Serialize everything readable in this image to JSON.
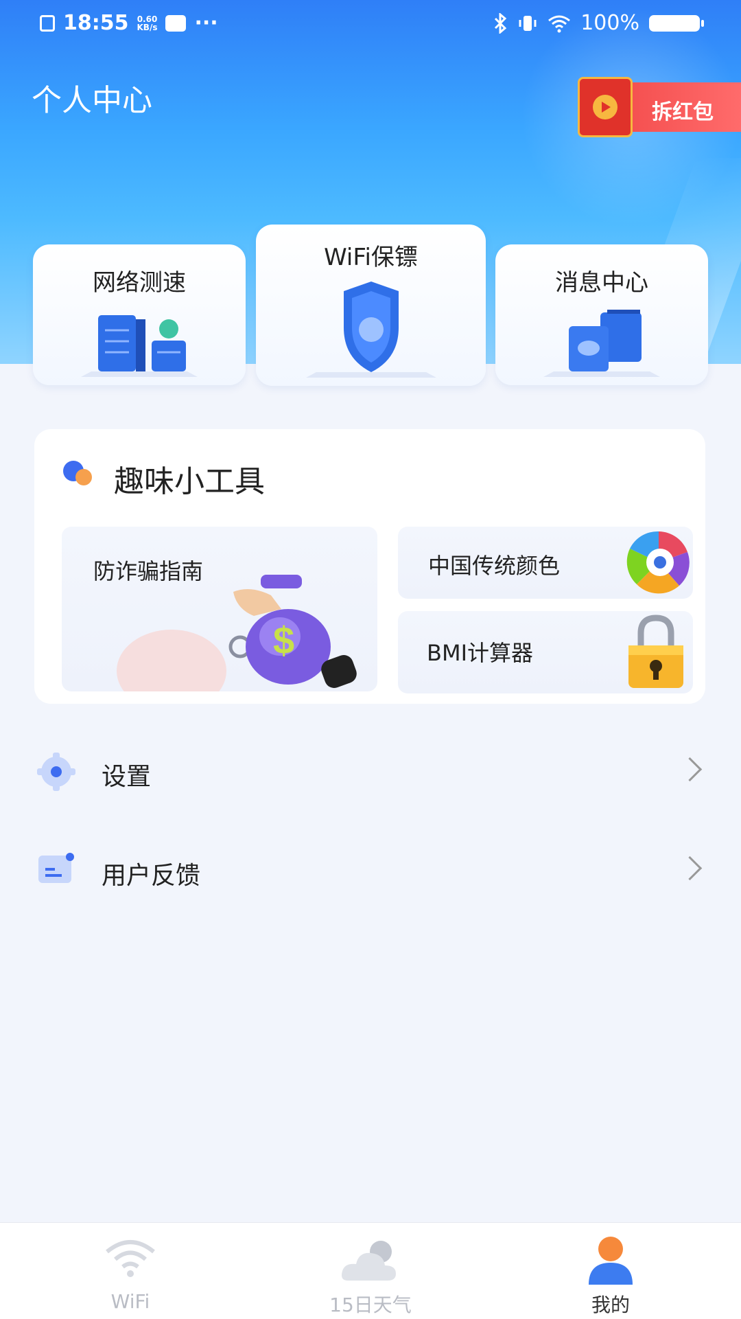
{
  "status_bar": {
    "time": "18:55",
    "speed_top": "0.60",
    "speed_bottom": "KB/s",
    "more": "···",
    "battery": "100%"
  },
  "header": {
    "title": "个人中心",
    "red_packet_label": "拆红包"
  },
  "feature_cards": [
    {
      "label": "网络测速",
      "icon": "server-speed-icon"
    },
    {
      "label": "WiFi保镖",
      "icon": "shield-icon"
    },
    {
      "label": "消息中心",
      "icon": "message-boxes-icon"
    }
  ],
  "tools": {
    "title": "趣味小工具",
    "items": [
      {
        "label": "防诈骗指南",
        "icon": "money-bag-icon"
      },
      {
        "label": "中国传统颜色",
        "icon": "color-wheel-icon"
      },
      {
        "label": "BMI计算器",
        "icon": "padlock-icon"
      }
    ]
  },
  "menu": [
    {
      "label": "设置",
      "icon": "gear-icon"
    },
    {
      "label": "用户反馈",
      "icon": "feedback-icon"
    }
  ],
  "tabbar": [
    {
      "label": "WiFi",
      "icon": "wifi-icon",
      "active": false
    },
    {
      "label": "15日天气",
      "icon": "cloud-icon",
      "active": false
    },
    {
      "label": "我的",
      "icon": "user-icon",
      "active": true
    }
  ],
  "colors": {
    "accent": "#2f7ff7",
    "red_packet": "#f04545",
    "active_tab_head": "#f6893b",
    "active_tab_body": "#3d7cf0"
  }
}
